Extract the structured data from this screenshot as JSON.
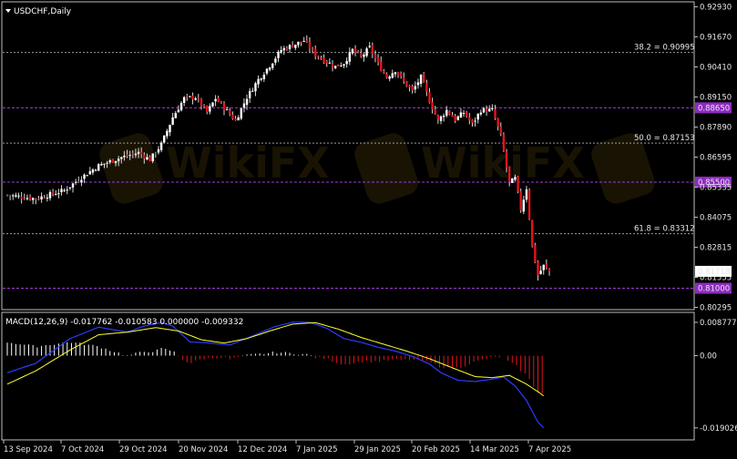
{
  "chart_window": {
    "symbol_title": "USDCHF,Daily",
    "macd_title": "MACD(12,26,9) -0.017762 -0.010583 0.000000 -0.009332",
    "watermark": "WikiFX"
  },
  "chart_data": [
    {
      "type": "candlestick",
      "title": "USDCHF,Daily",
      "ylim": [
        0.8019,
        0.9293
      ],
      "price_ticks": [
        "0.92930",
        "0.91670",
        "0.90410",
        "0.89150",
        "0.87890",
        "0.86595",
        "0.85335",
        "0.84075",
        "0.82815",
        "0.81555",
        "0.80295"
      ],
      "current_price": "0.81718",
      "date_ticks": [
        "13 Sep 2024",
        "7 Oct 2024",
        "29 Oct 2024",
        "20 Nov 2024",
        "12 Dec 2024",
        "7 Jan 2025",
        "29 Jan 2025",
        "20 Feb 2025",
        "14 Mar 2025",
        "7 Apr 2025"
      ],
      "fib_levels": [
        {
          "label": "38.2 = 0.90995",
          "value": 0.90995
        },
        {
          "label": "50.0 = 0.87153",
          "value": 0.87153
        },
        {
          "label": "61.8 = 0.83312",
          "value": 0.83312
        }
      ],
      "horizontal_lines": [
        {
          "label": "0.88650",
          "value": 0.8865
        },
        {
          "label": "0.85500",
          "value": 0.855
        },
        {
          "label": "0.81000",
          "value": 0.81
        }
      ],
      "close_path": [
        [
          0,
          0.8495
        ],
        [
          10,
          0.848
        ],
        [
          20,
          0.8515
        ],
        [
          26,
          0.857
        ],
        [
          32,
          0.862
        ],
        [
          40,
          0.8655
        ],
        [
          46,
          0.8675
        ],
        [
          50,
          0.8645
        ],
        [
          54,
          0.871
        ],
        [
          58,
          0.8825
        ],
        [
          62,
          0.8905
        ],
        [
          66,
          0.891
        ],
        [
          70,
          0.8845
        ],
        [
          73,
          0.8905
        ],
        [
          76,
          0.8865
        ],
        [
          80,
          0.881
        ],
        [
          84,
          0.891
        ],
        [
          88,
          0.8985
        ],
        [
          92,
          0.9045
        ],
        [
          96,
          0.911
        ],
        [
          100,
          0.913
        ],
        [
          104,
          0.915
        ],
        [
          108,
          0.909
        ],
        [
          112,
          0.906
        ],
        [
          115,
          0.904
        ],
        [
          118,
          0.9055
        ],
        [
          121,
          0.911
        ],
        [
          124,
          0.908
        ],
        [
          127,
          0.912
        ],
        [
          130,
          0.905
        ],
        [
          133,
          0.8995
        ],
        [
          136,
          0.9025
        ],
        [
          139,
          0.8975
        ],
        [
          142,
          0.8935
        ],
        [
          145,
          0.8995
        ],
        [
          148,
          0.8895
        ],
        [
          151,
          0.881
        ],
        [
          154,
          0.8855
        ],
        [
          157,
          0.8815
        ],
        [
          160,
          0.8845
        ],
        [
          163,
          0.8795
        ],
        [
          166,
          0.8855
        ],
        [
          170,
          0.8855
        ],
        [
          173,
          0.8745
        ],
        [
          176,
          0.8545
        ],
        [
          178,
          0.8565
        ],
        [
          180,
          0.8435
        ],
        [
          182,
          0.8525
        ],
        [
          184,
          0.8275
        ],
        [
          186,
          0.8155
        ],
        [
          188,
          0.8195
        ],
        [
          190,
          0.8172
        ]
      ]
    },
    {
      "type": "bar",
      "title": "MACD(12,26,9) -0.017762 -0.010583 0.000000 -0.009332",
      "ylim": [
        -0.02146,
        0.0102
      ],
      "ticks": [
        "0.008777",
        "0.00",
        "-0.019026"
      ],
      "series": [
        {
          "name": "MACD",
          "values": [
            [
              0,
              -0.0045
            ],
            [
              10,
              -0.002
            ],
            [
              22,
              0.0045
            ],
            [
              32,
              0.0075
            ],
            [
              42,
              0.0062
            ],
            [
              48,
              0.0078
            ],
            [
              54,
              0.0087
            ],
            [
              58,
              0.0078
            ],
            [
              64,
              0.0036
            ],
            [
              70,
              0.0034
            ],
            [
              78,
              0.0028
            ],
            [
              86,
              0.0052
            ],
            [
              94,
              0.0077
            ],
            [
              100,
              0.0088
            ],
            [
              106,
              0.0088
            ],
            [
              112,
              0.0072
            ],
            [
              118,
              0.0045
            ],
            [
              124,
              0.0035
            ],
            [
              130,
              0.0022
            ],
            [
              136,
              0.0012
            ],
            [
              142,
              -0.0002
            ],
            [
              148,
              -0.0022
            ],
            [
              152,
              -0.0045
            ],
            [
              158,
              -0.0065
            ],
            [
              164,
              -0.0068
            ],
            [
              170,
              -0.0062
            ],
            [
              174,
              -0.0056
            ],
            [
              178,
              -0.008
            ],
            [
              182,
              -0.0118
            ],
            [
              186,
              -0.0175
            ],
            [
              188,
              -0.019
            ]
          ]
        },
        {
          "name": "Signal",
          "values": [
            [
              0,
              -0.0075
            ],
            [
              10,
              -0.004
            ],
            [
              22,
              0.0015
            ],
            [
              32,
              0.0055
            ],
            [
              42,
              0.0062
            ],
            [
              52,
              0.0074
            ],
            [
              60,
              0.0065
            ],
            [
              68,
              0.0042
            ],
            [
              76,
              0.0033
            ],
            [
              84,
              0.0045
            ],
            [
              92,
              0.0065
            ],
            [
              100,
              0.0083
            ],
            [
              108,
              0.0087
            ],
            [
              116,
              0.007
            ],
            [
              124,
              0.0048
            ],
            [
              132,
              0.003
            ],
            [
              140,
              0.0012
            ],
            [
              148,
              -0.0008
            ],
            [
              156,
              -0.0032
            ],
            [
              164,
              -0.0055
            ],
            [
              170,
              -0.0058
            ],
            [
              176,
              -0.0052
            ],
            [
              182,
              -0.0075
            ],
            [
              186,
              -0.0095
            ],
            [
              188,
              -0.0106
            ]
          ]
        }
      ]
    }
  ]
}
